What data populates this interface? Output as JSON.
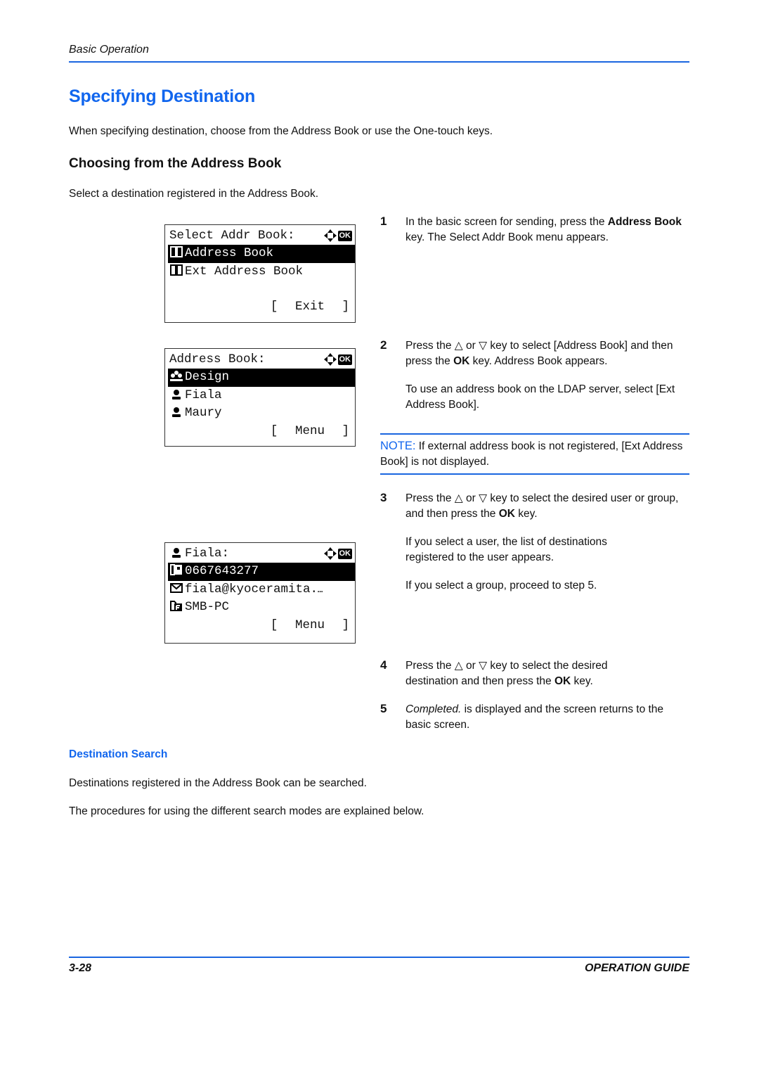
{
  "header": {
    "running_head": "Basic Operation"
  },
  "title": "Specifying Destination",
  "intro": "When specifying destination, choose from the Address Book or use the One-touch keys.",
  "section": {
    "heading": "Choosing from the Address Book",
    "intro": "Select a destination registered in the Address Book."
  },
  "panels": {
    "select_addr_book": {
      "title": "Select Addr Book:",
      "ok_label": "OK",
      "items": [
        {
          "icon": "address-book-icon",
          "label": "Address Book",
          "selected": true
        },
        {
          "icon": "ext-address-book-icon",
          "label": "Ext Address Book",
          "selected": false
        }
      ],
      "softkey": {
        "open": "[",
        "label": "Exit",
        "close": "]"
      }
    },
    "address_book": {
      "title": "Address Book:",
      "ok_label": "OK",
      "items": [
        {
          "icon": "group-icon",
          "label": "Design",
          "selected": true
        },
        {
          "icon": "user-icon",
          "label": "Fiala",
          "selected": false
        },
        {
          "icon": "user-icon",
          "label": "Maury",
          "selected": false
        }
      ],
      "softkey": {
        "open": "[",
        "label": "Menu",
        "close": "]"
      }
    },
    "user_detail": {
      "title": "Fiala:",
      "ok_label": "OK",
      "items": [
        {
          "icon": "fax-icon",
          "label": "0667643277",
          "selected": true
        },
        {
          "icon": "email-icon",
          "label": "fiala@kyoceramita.",
          "selected": false
        },
        {
          "icon": "folder-icon",
          "label": "SMB-PC",
          "selected": false
        }
      ],
      "ellipsis": "…",
      "softkey": {
        "open": "[",
        "label": "Menu",
        "close": "]"
      }
    }
  },
  "steps": [
    {
      "num": "1",
      "parts": [
        {
          "t": "In the basic screen for sending, press the "
        },
        {
          "t": "Address Book",
          "b": true
        },
        {
          "t": " key. The Select Addr Book menu appears."
        }
      ]
    },
    {
      "num": "2",
      "parts": [
        {
          "t": "Press the △ or ▽ key to select [Address Book] and then press the "
        },
        {
          "t": "OK",
          "b": true
        },
        {
          "t": " key. Address Book appears."
        }
      ],
      "extra": "To use an address book on the LDAP server, select [Ext Address Book]."
    },
    {
      "num": "3",
      "parts": [
        {
          "t": "Press the △ or ▽ key to select the desired user or group, and then press the "
        },
        {
          "t": "OK",
          "b": true
        },
        {
          "t": " key."
        }
      ],
      "extra": "If you select a user, the list of destinations registered to the user appears.",
      "extra2": "If you select a group, proceed to step 5."
    },
    {
      "num": "4",
      "parts": [
        {
          "t": "Press the △ or ▽ key to select the desired destination and then press the "
        },
        {
          "t": "OK",
          "b": true
        },
        {
          "t": " key."
        }
      ]
    },
    {
      "num": "5",
      "parts": [
        {
          "t": "Completed.",
          "i": true
        },
        {
          "t": " is displayed and the screen returns to the basic screen."
        }
      ]
    }
  ],
  "note": {
    "label": "NOTE:",
    "text": " If external address book is not registered, [Ext Address Book] is not displayed."
  },
  "subsection": {
    "heading": "Destination Search",
    "p1": "Destinations registered in the Address Book can be searched.",
    "p2": "The procedures for using the different search modes are explained below."
  },
  "footer": {
    "page": "3-28",
    "title": "OPERATION GUIDE"
  },
  "colors": {
    "accent": "#1166ee",
    "rule": "#1a66e0"
  }
}
